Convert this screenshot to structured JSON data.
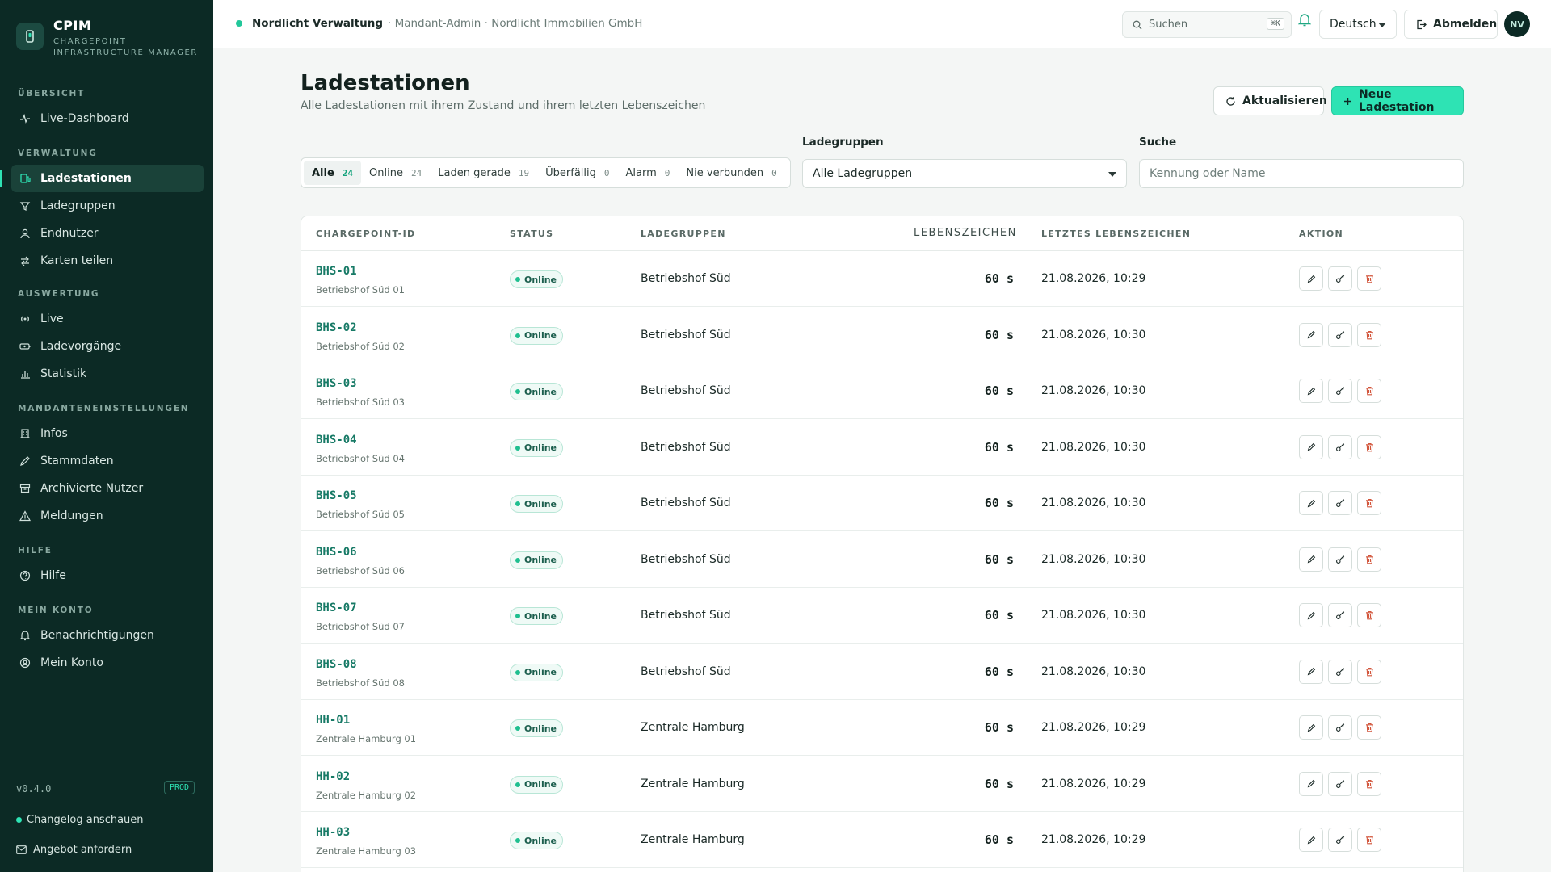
{
  "brand": {
    "title": "CPIM",
    "subtitle_line1": "CHARGEPOINT",
    "subtitle_line2": "INFRASTRUCTURE MANAGER"
  },
  "sidebar": {
    "sections": [
      "ÜBERSICHT",
      "VERWALTUNG",
      "AUSWERTUNG",
      "MANDANTENEINSTELLUNGEN",
      "HILFE",
      "MEIN KONTO"
    ],
    "items": [
      {
        "label": "Live-Dashboard",
        "icon": "pulse-icon"
      },
      {
        "label": "Ladestationen",
        "icon": "charging-station-icon",
        "active": true
      },
      {
        "label": "Ladegruppen",
        "icon": "group-icon"
      },
      {
        "label": "Endnutzer",
        "icon": "user-icon"
      },
      {
        "label": "Karten teilen",
        "icon": "share-arrows-icon"
      },
      {
        "label": "Live",
        "icon": "broadcast-icon"
      },
      {
        "label": "Ladevorgänge",
        "icon": "battery-icon"
      },
      {
        "label": "Statistik",
        "icon": "bar-chart-icon"
      },
      {
        "label": "Infos",
        "icon": "building-icon"
      },
      {
        "label": "Stammdaten",
        "icon": "pencil-icon"
      },
      {
        "label": "Archivierte Nutzer",
        "icon": "archive-icon"
      },
      {
        "label": "Meldungen",
        "icon": "warning-icon"
      },
      {
        "label": "Hilfe",
        "icon": "help-icon"
      },
      {
        "label": "Benachrichtigungen",
        "icon": "bell-icon"
      },
      {
        "label": "Mein Konto",
        "icon": "account-icon"
      }
    ],
    "version": "v0.4.0",
    "env_badge": "PROD",
    "changelog": "Changelog anschauen",
    "offer": "Angebot anfordern"
  },
  "header": {
    "tenant_name": "Nordlicht Verwaltung",
    "tenant_meta": "· Mandant-Admin · Nordlicht Immobilien GmbH",
    "search_label": "Suchen",
    "search_kbd": "⌘K",
    "language": "Deutsch",
    "logout": "Abmelden",
    "avatar": "NV"
  },
  "page": {
    "title": "Ladestationen",
    "subtitle": "Alle Ladestationen mit ihrem Zustand und ihrem letzten Lebenszeichen",
    "refresh_label": "Aktualisieren",
    "new_label": "Neue Ladestation"
  },
  "filters": {
    "segments": [
      {
        "label": "Alle",
        "count": "24",
        "active": true
      },
      {
        "label": "Online",
        "count": "24"
      },
      {
        "label": "Laden gerade",
        "count": "19"
      },
      {
        "label": "Überfällig",
        "count": "0"
      },
      {
        "label": "Alarm",
        "count": "0"
      },
      {
        "label": "Nie verbunden",
        "count": "0"
      }
    ],
    "group_label": "Ladegruppen",
    "group_value": "Alle Ladegruppen",
    "search_label": "Suche",
    "search_placeholder": "Kennung oder Name"
  },
  "table": {
    "columns": [
      "CHARGEPOINT-ID",
      "STATUS",
      "LADEGRUPPEN",
      "LEBENSZEICHEN",
      "LETZTES LEBENSZEICHEN",
      "AKTION"
    ],
    "rows": [
      {
        "id": "BHS-01",
        "name": "Betriebshof Süd 01",
        "status": "Online",
        "group": "Betriebshof Süd",
        "heartbeat": "60 s",
        "last": "21.08.2026, 10:29"
      },
      {
        "id": "BHS-02",
        "name": "Betriebshof Süd 02",
        "status": "Online",
        "group": "Betriebshof Süd",
        "heartbeat": "60 s",
        "last": "21.08.2026, 10:30"
      },
      {
        "id": "BHS-03",
        "name": "Betriebshof Süd 03",
        "status": "Online",
        "group": "Betriebshof Süd",
        "heartbeat": "60 s",
        "last": "21.08.2026, 10:30"
      },
      {
        "id": "BHS-04",
        "name": "Betriebshof Süd 04",
        "status": "Online",
        "group": "Betriebshof Süd",
        "heartbeat": "60 s",
        "last": "21.08.2026, 10:30"
      },
      {
        "id": "BHS-05",
        "name": "Betriebshof Süd 05",
        "status": "Online",
        "group": "Betriebshof Süd",
        "heartbeat": "60 s",
        "last": "21.08.2026, 10:30"
      },
      {
        "id": "BHS-06",
        "name": "Betriebshof Süd 06",
        "status": "Online",
        "group": "Betriebshof Süd",
        "heartbeat": "60 s",
        "last": "21.08.2026, 10:30"
      },
      {
        "id": "BHS-07",
        "name": "Betriebshof Süd 07",
        "status": "Online",
        "group": "Betriebshof Süd",
        "heartbeat": "60 s",
        "last": "21.08.2026, 10:30"
      },
      {
        "id": "BHS-08",
        "name": "Betriebshof Süd 08",
        "status": "Online",
        "group": "Betriebshof Süd",
        "heartbeat": "60 s",
        "last": "21.08.2026, 10:30"
      },
      {
        "id": "HH-01",
        "name": "Zentrale Hamburg 01",
        "status": "Online",
        "group": "Zentrale Hamburg",
        "heartbeat": "60 s",
        "last": "21.08.2026, 10:29"
      },
      {
        "id": "HH-02",
        "name": "Zentrale Hamburg 02",
        "status": "Online",
        "group": "Zentrale Hamburg",
        "heartbeat": "60 s",
        "last": "21.08.2026, 10:29"
      },
      {
        "id": "HH-03",
        "name": "Zentrale Hamburg 03",
        "status": "Online",
        "group": "Zentrale Hamburg",
        "heartbeat": "60 s",
        "last": "21.08.2026, 10:29"
      }
    ]
  },
  "colors": {
    "sidebar_bg": "#0c2a25",
    "accent": "#2ee3b4",
    "id_link": "#177a66",
    "online": "#1fbf8f",
    "delete": "#d2553b"
  }
}
